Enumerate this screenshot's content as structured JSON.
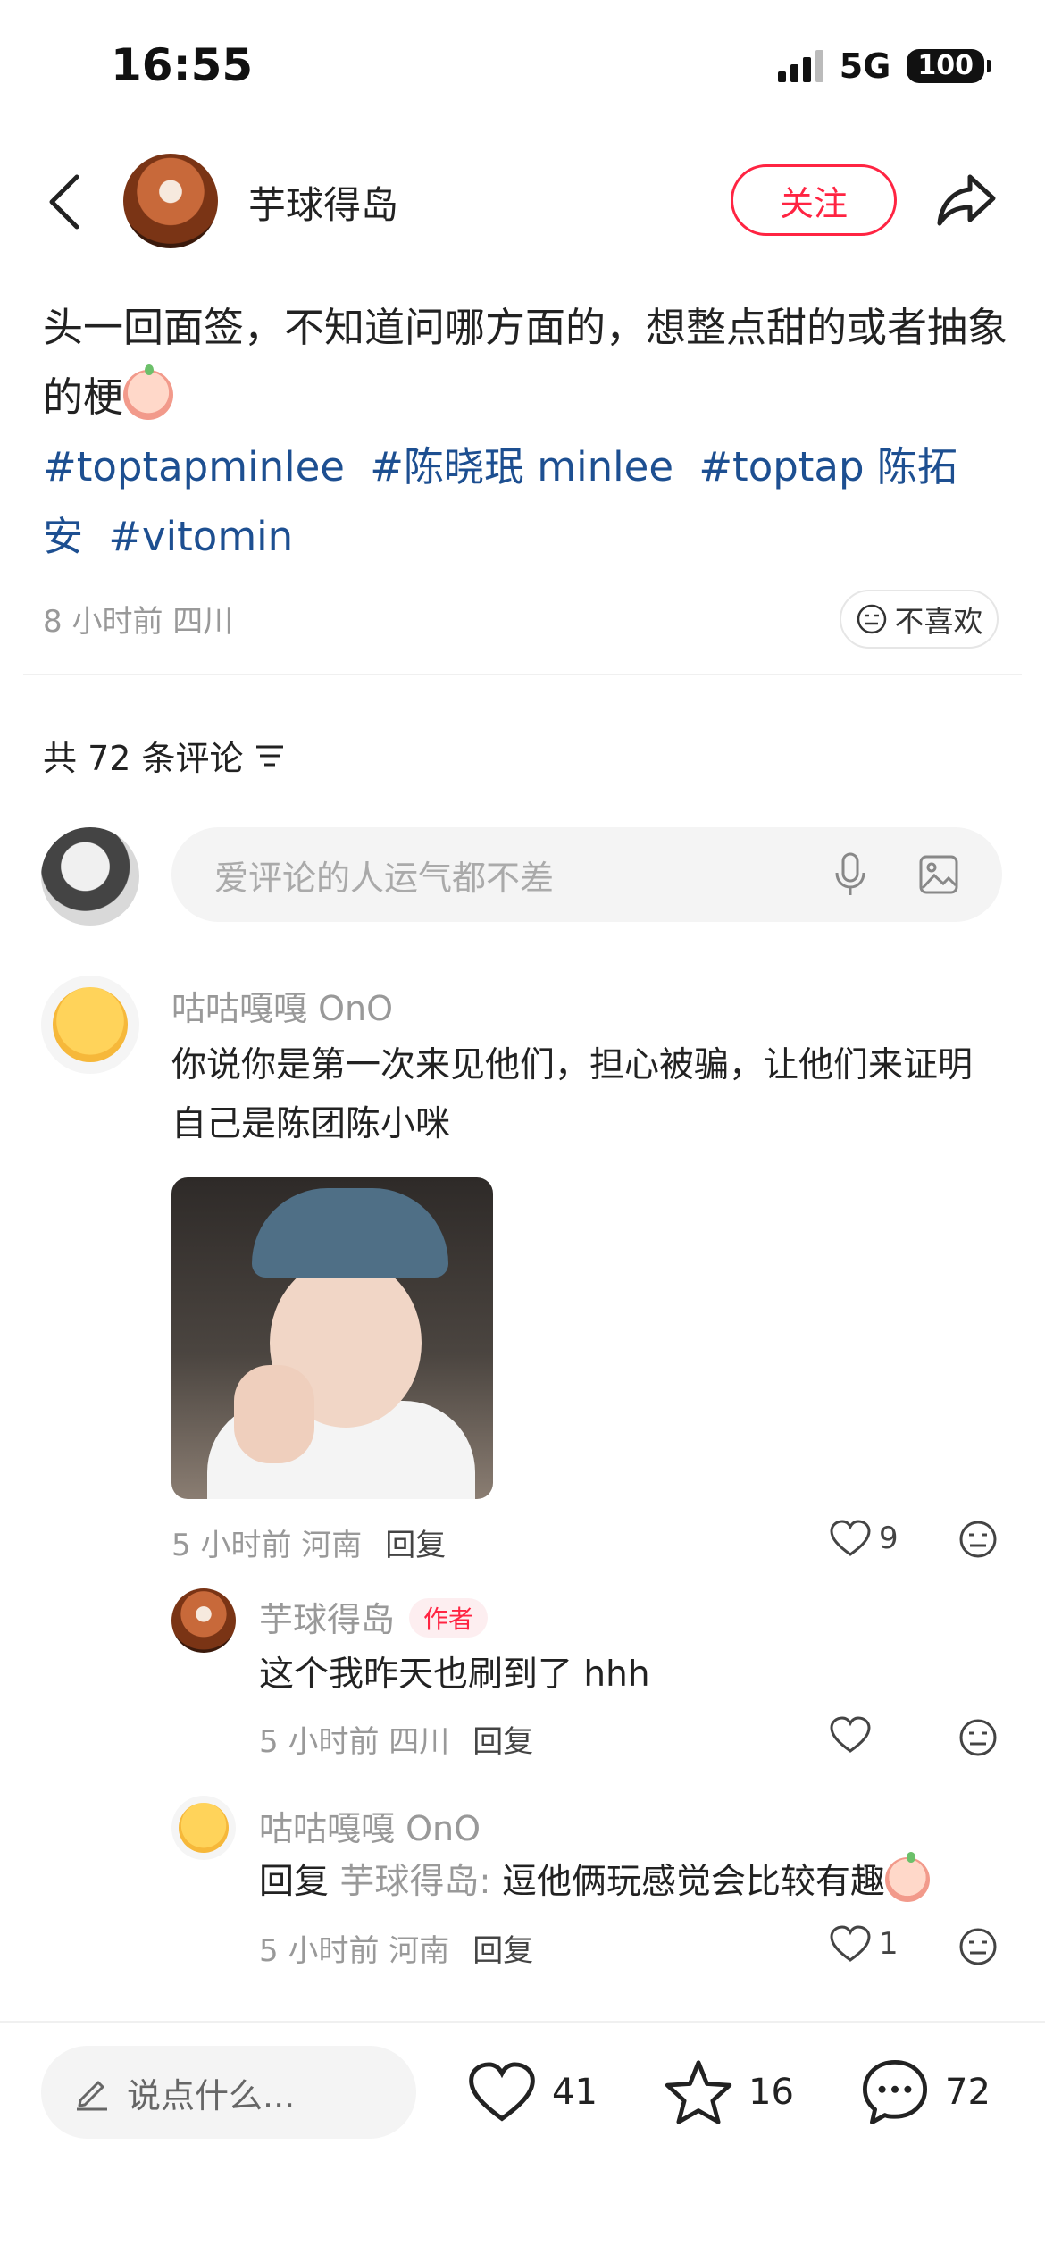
{
  "status_bar": {
    "time": "16:55",
    "network": "5G",
    "battery": "100"
  },
  "header": {
    "author_name": "芋球得岛",
    "follow_label": "关注"
  },
  "post": {
    "text": "头一回面签，不知道问哪方面的，想整点甜的或者抽象的梗",
    "tags": [
      "#toptapminlee",
      "#陈晓珉 minlee",
      "#toptap 陈拓安",
      "#vitomin"
    ],
    "meta": "8 小时前 四川",
    "dislike_label": "不喜欢"
  },
  "comments_section": {
    "count_label": "共 72 条评论",
    "input_placeholder": "爱评论的人运气都不差"
  },
  "comments": [
    {
      "user": "咕咕嘎嘎 OnO",
      "text": "你说你是第一次来见他们，担心被骗，让他们来证明自己是陈团陈小咪",
      "time_location": "5 小时前 河南",
      "reply_label": "回复",
      "likes": "9"
    }
  ],
  "replies": [
    {
      "user": "芋球得岛",
      "badge": "作者",
      "text": "这个我昨天也刷到了 hhh",
      "time_location": "5 小时前 四川",
      "reply_label": "回复",
      "likes": ""
    },
    {
      "user": "咕咕嘎嘎 OnO",
      "reply_prefix": "回复",
      "reply_to": "芋球得岛:",
      "text": "逗他俩玩感觉会比较有趣",
      "time_location": "5 小时前 河南",
      "reply_label": "回复",
      "likes": "1"
    }
  ],
  "bottom_bar": {
    "input_placeholder": "说点什么...",
    "likes": "41",
    "favorites": "16",
    "comments": "72"
  },
  "colors": {
    "accent": "#ff2442",
    "hashtag": "#1d4f91",
    "muted": "#999999"
  }
}
